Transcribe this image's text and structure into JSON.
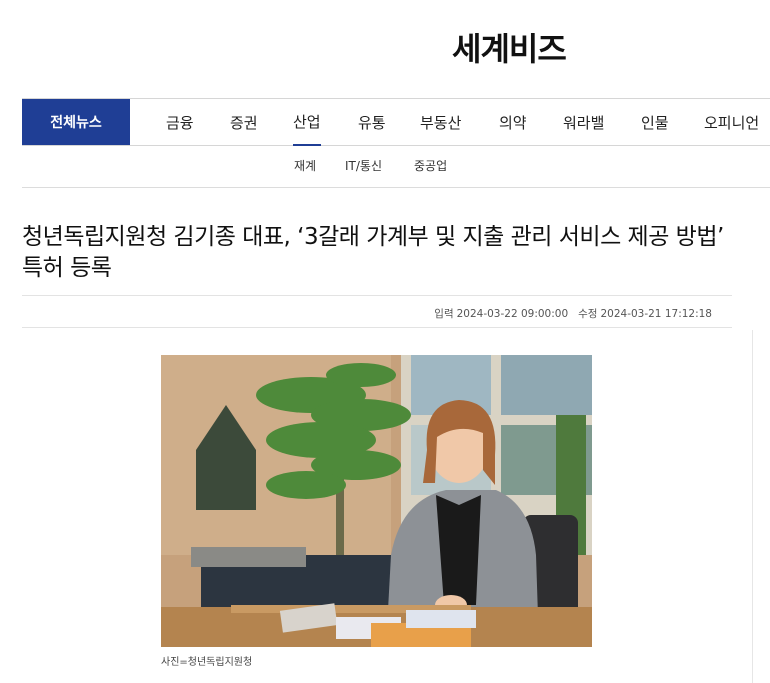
{
  "header": {
    "logo": "세계비즈"
  },
  "nav": {
    "all_label": "전체뉴스",
    "items": [
      {
        "label": "금융"
      },
      {
        "label": "증권"
      },
      {
        "label": "산업"
      },
      {
        "label": "유통"
      },
      {
        "label": "부동산"
      },
      {
        "label": "의약"
      },
      {
        "label": "워라밸"
      },
      {
        "label": "인물"
      },
      {
        "label": "오피니언"
      }
    ],
    "active_label": "산업",
    "accent_color": "#1f3e95"
  },
  "subnav": {
    "items": [
      {
        "label": "재계"
      },
      {
        "label": "IT/통신"
      },
      {
        "label": "중공업"
      }
    ]
  },
  "article": {
    "title": "청년독립지원청 김기종 대표, ‘3갈래 가계부 및 지출 관리 서비스 제공 방법’ 특허 등록",
    "published_label": "입력",
    "published": "2024-03-22 09:00:00",
    "modified_label": "수정",
    "modified": "2024-03-21 17:12:18",
    "photo_caption": "사진=청년독립지원청"
  }
}
